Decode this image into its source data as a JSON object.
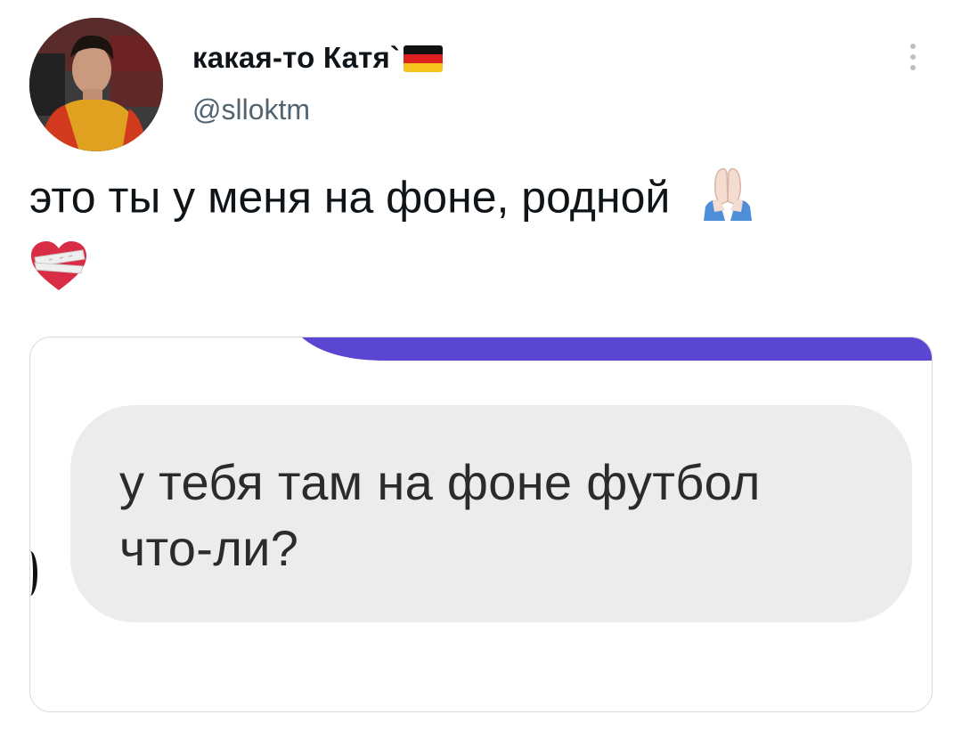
{
  "tweet": {
    "display_name": "какая-то Катя`",
    "handle": "@slloktm",
    "text": "это ты у меня на фоне, родной",
    "flag_icon": "germany-flag-icon",
    "emojis": [
      "folded-hands-light-skin-tone",
      "mending-heart"
    ],
    "more_icon": "more-vertical-icon"
  },
  "attachment": {
    "message_text": "у тебя там на фоне футбол\nчто-ли?",
    "accent_color": "#5a46d1",
    "bubble_color": "#ececec"
  },
  "colors": {
    "text_primary": "#0f1419",
    "text_secondary": "#536471",
    "border": "#d6dde2"
  }
}
